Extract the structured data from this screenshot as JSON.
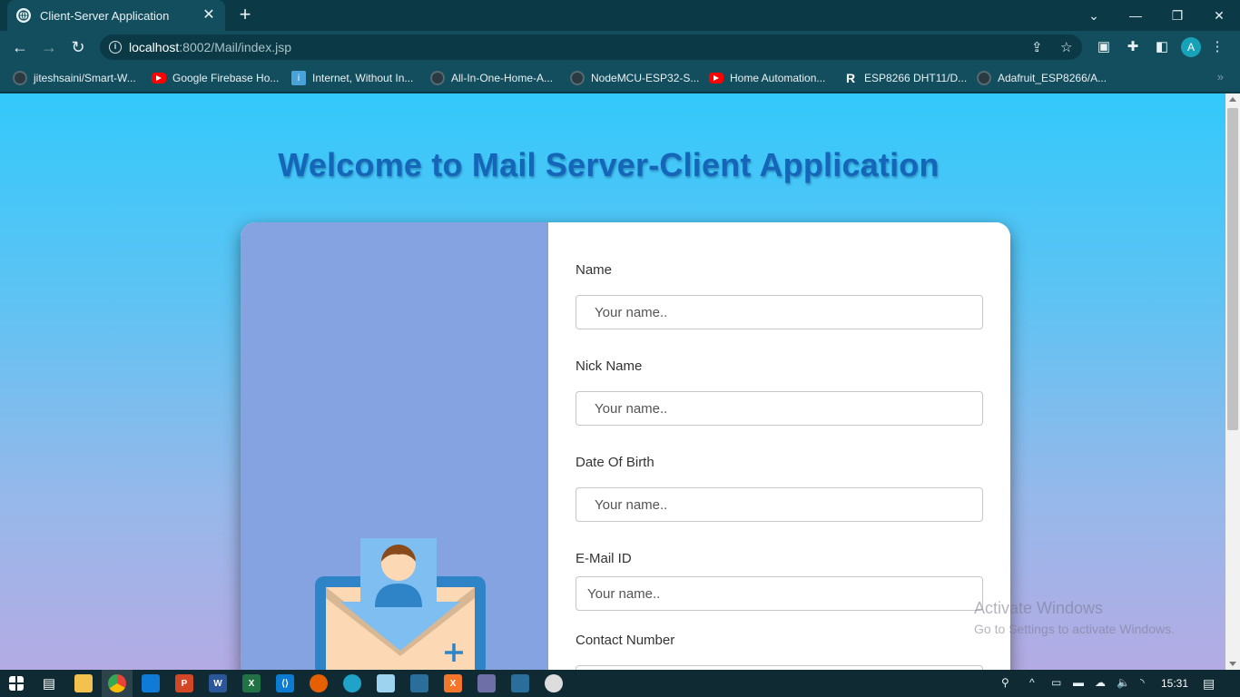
{
  "browser": {
    "tab_title": "Client-Server Application",
    "tab_close": "✕",
    "new_tab": "+",
    "url_host": "localhost",
    "url_path": ":8002/Mail/index.jsp",
    "profile_initial": "A",
    "window_controls": [
      "⌄",
      "—",
      "❐",
      "✕"
    ],
    "nav": {
      "back": "←",
      "forward": "→",
      "reload": "↻"
    }
  },
  "bookmarks": [
    {
      "label": "jiteshsaini/Smart-W...",
      "icon": "github-icon"
    },
    {
      "label": "Google Firebase Ho...",
      "icon": "youtube-icon"
    },
    {
      "label": "Internet, Without In...",
      "icon": "internet-icon"
    },
    {
      "label": "All-In-One-Home-A...",
      "icon": "github-icon"
    },
    {
      "label": "NodeMCU-ESP32-S...",
      "icon": "github-icon"
    },
    {
      "label": "Home Automation...",
      "icon": "youtube-icon"
    },
    {
      "label": "ESP8266 DHT11/D...",
      "icon": "r-icon"
    },
    {
      "label": "Adafruit_ESP8266/A...",
      "icon": "github-icon"
    }
  ],
  "page": {
    "heading": "Welcome to Mail Server-Client Application",
    "form": {
      "name_label": "Name",
      "name_placeholder": "Your name..",
      "nick_label": "Nick Name",
      "nick_placeholder": "Your name..",
      "dob_label": "Date Of Birth",
      "dob_placeholder": "Your name..",
      "email_label": "E-Mail ID",
      "email_placeholder": "Your name..",
      "contact_label": "Contact Number"
    }
  },
  "watermark": {
    "title": "Activate Windows",
    "subtitle": "Go to Settings to activate Windows."
  },
  "taskbar": {
    "time": "15:31"
  },
  "colors": {
    "heading": "#1565b8",
    "card_left": "#85a3e0",
    "browser_frame": "#134e5e"
  }
}
